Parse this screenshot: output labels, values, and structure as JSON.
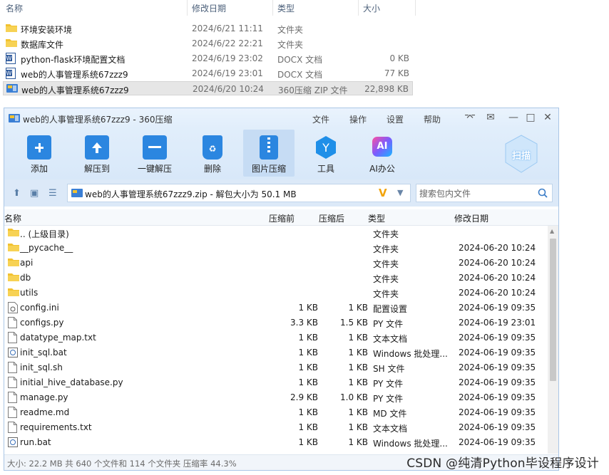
{
  "explorer": {
    "headers": {
      "name": "名称",
      "date": "修改日期",
      "type": "类型",
      "size": "大小"
    },
    "rows": [
      {
        "name": "环境安装环境",
        "date": "2024/6/21 11:11",
        "type": "文件夹",
        "size": ""
      },
      {
        "name": "数据库文件",
        "date": "2024/6/22 22:21",
        "type": "文件夹",
        "size": ""
      },
      {
        "name": "python-flask环境配置文档",
        "date": "2024/6/19 23:02",
        "type": "DOCX 文档",
        "size": "0 KB"
      },
      {
        "name": "web的人事管理系统67zzz9",
        "date": "2024/6/19 23:01",
        "type": "DOCX 文档",
        "size": "77 KB"
      },
      {
        "name": "web的人事管理系统67zzz9",
        "date": "2024/6/20 10:24",
        "type": "360压缩 ZIP 文件",
        "size": "22,898 KB"
      }
    ]
  },
  "window": {
    "title": "web的人事管理系统67zzz9 - 360压缩",
    "menu": [
      "文件",
      "操作",
      "设置",
      "帮助"
    ],
    "toolbar": [
      "添加",
      "解压到",
      "一键解压",
      "删除",
      "图片压缩",
      "工具",
      "AI办公"
    ],
    "scan_label": "扫描",
    "address": "web的人事管理系统67zzz9.zip - 解包大小为 50.1 MB",
    "search_placeholder": "搜索包内文件",
    "columns": {
      "name": "名称",
      "csize": "压缩前",
      "psize": "压缩后",
      "type": "类型",
      "date": "修改日期"
    },
    "files": [
      {
        "name": ".. (上级目录)",
        "c": "",
        "p": "",
        "type": "文件夹",
        "date": "",
        "kind": "folder"
      },
      {
        "name": "__pycache__",
        "c": "",
        "p": "",
        "type": "文件夹",
        "date": "2024-06-20 10:24",
        "kind": "folder"
      },
      {
        "name": "api",
        "c": "",
        "p": "",
        "type": "文件夹",
        "date": "2024-06-20 10:24",
        "kind": "folder"
      },
      {
        "name": "db",
        "c": "",
        "p": "",
        "type": "文件夹",
        "date": "2024-06-20 10:24",
        "kind": "folder"
      },
      {
        "name": "utils",
        "c": "",
        "p": "",
        "type": "文件夹",
        "date": "2024-06-20 10:24",
        "kind": "folder"
      },
      {
        "name": "config.ini",
        "c": "1 KB",
        "p": "1 KB",
        "type": "配置设置",
        "date": "2024-06-19 09:35",
        "kind": "ini"
      },
      {
        "name": "configs.py",
        "c": "3.3 KB",
        "p": "1.5 KB",
        "type": "PY 文件",
        "date": "2024-06-19 23:01",
        "kind": "file"
      },
      {
        "name": "datatype_map.txt",
        "c": "1 KB",
        "p": "1 KB",
        "type": "文本文档",
        "date": "2024-06-19 09:35",
        "kind": "file"
      },
      {
        "name": "init_sql.bat",
        "c": "1 KB",
        "p": "1 KB",
        "type": "Windows 批处理...",
        "date": "2024-06-19 09:35",
        "kind": "bat"
      },
      {
        "name": "init_sql.sh",
        "c": "1 KB",
        "p": "1 KB",
        "type": "SH 文件",
        "date": "2024-06-19 09:35",
        "kind": "file"
      },
      {
        "name": "initial_hive_database.py",
        "c": "1 KB",
        "p": "1 KB",
        "type": "PY 文件",
        "date": "2024-06-19 09:35",
        "kind": "file"
      },
      {
        "name": "manage.py",
        "c": "2.9 KB",
        "p": "1.0 KB",
        "type": "PY 文件",
        "date": "2024-06-19 09:35",
        "kind": "file"
      },
      {
        "name": "readme.md",
        "c": "1 KB",
        "p": "1 KB",
        "type": "MD 文件",
        "date": "2024-06-19 09:35",
        "kind": "file"
      },
      {
        "name": "requirements.txt",
        "c": "1 KB",
        "p": "1 KB",
        "type": "文本文档",
        "date": "2024-06-19 09:35",
        "kind": "file"
      },
      {
        "name": "run.bat",
        "c": "1 KB",
        "p": "1 KB",
        "type": "Windows 批处理...",
        "date": "2024-06-19 09:35",
        "kind": "bat"
      }
    ],
    "status": "大小: 22.2 MB 共 640 个文件和 114 个文件夹 压缩率 44.3%"
  },
  "watermark": "CSDN @纯清Python毕设程序设计",
  "colors": {
    "folder": "#f2c230",
    "accent": "#2a86e0",
    "title_bg": "#e3effc"
  }
}
